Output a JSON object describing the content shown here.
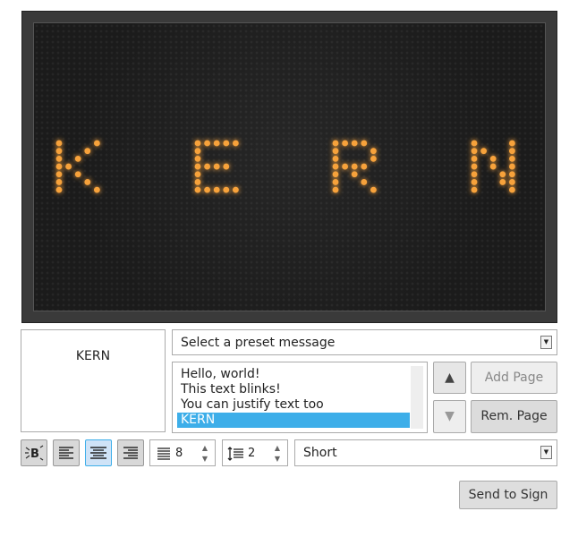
{
  "sign": {
    "text": "KERN",
    "led_color": "#f7a23a"
  },
  "preview": {
    "text": "KERN"
  },
  "preset": {
    "selected": "Select a preset message"
  },
  "pages": {
    "items": [
      "Hello, world!",
      "This text blinks!",
      "You can justify text too",
      "KERN"
    ],
    "selected_index": 3
  },
  "buttons": {
    "move_up": "▲",
    "move_down": "▼",
    "add_page": "Add Page",
    "remove_page": "Rem. Page",
    "send": "Send to Sign"
  },
  "toolbar": {
    "font_size": "8",
    "line_spacing": "2",
    "speed": "Short",
    "alignment": "center"
  }
}
